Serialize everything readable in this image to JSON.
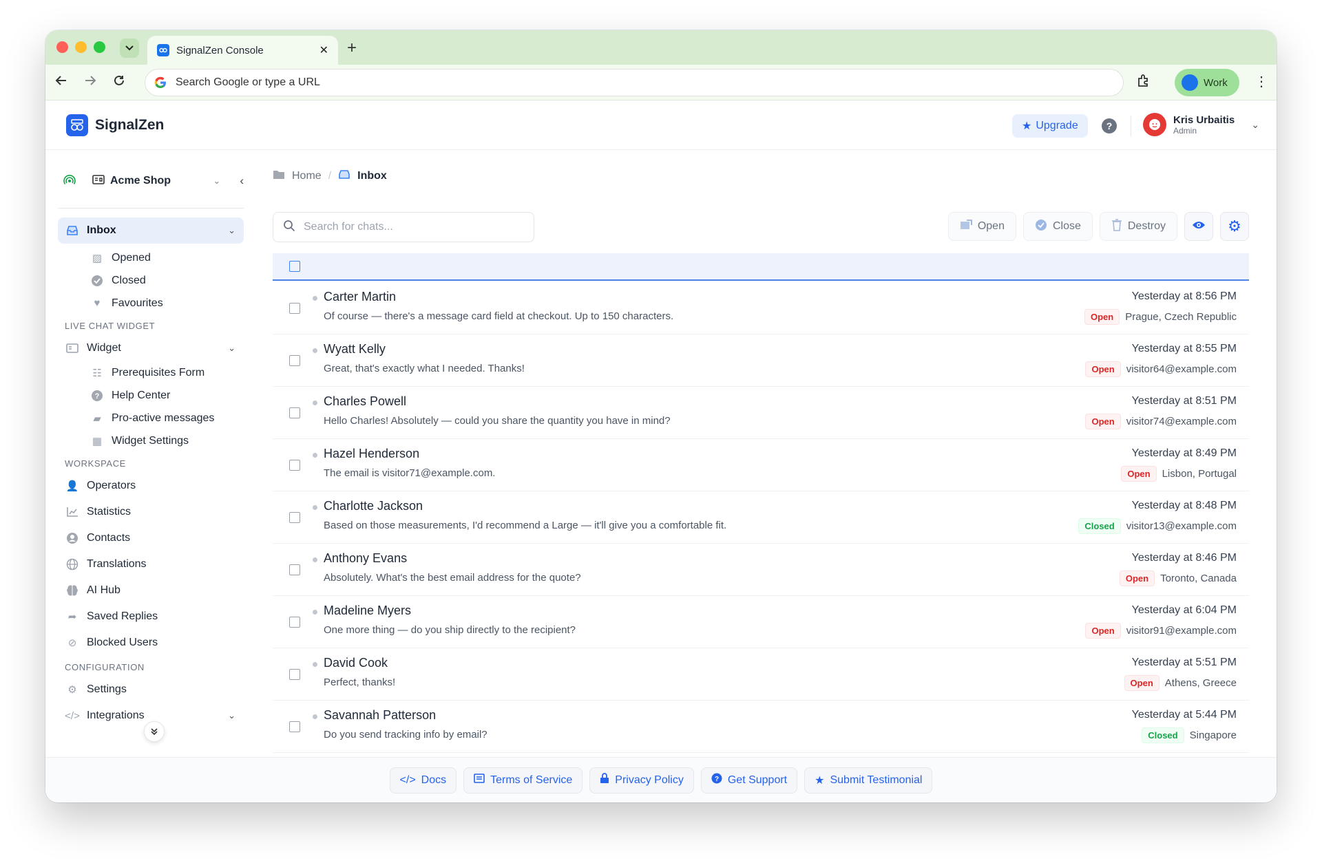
{
  "browser": {
    "tab_title": "SignalZen Console",
    "address_placeholder": "Search Google or type a URL",
    "profile_label": "Work"
  },
  "header": {
    "brand": "SignalZen",
    "upgrade_label": "Upgrade",
    "user_name": "Kris Urbaitis",
    "user_role": "Admin"
  },
  "sidebar": {
    "workspace": "Acme Shop",
    "inbox_label": "Inbox",
    "inbox_sub": [
      {
        "label": "Opened",
        "icon": "inbox-opened-icon"
      },
      {
        "label": "Closed",
        "icon": "check-circle-icon"
      },
      {
        "label": "Favourites",
        "icon": "heart-icon"
      }
    ],
    "section_widget": "LIVE CHAT WIDGET",
    "widget_label": "Widget",
    "widget_sub": [
      {
        "label": "Prerequisites Form",
        "icon": "checklist-icon"
      },
      {
        "label": "Help Center",
        "icon": "question-icon"
      },
      {
        "label": "Pro-active messages",
        "icon": "messages-icon"
      },
      {
        "label": "Widget Settings",
        "icon": "grid-icon"
      }
    ],
    "section_workspace": "WORKSPACE",
    "workspace_items": [
      {
        "label": "Operators",
        "icon": "operators-icon"
      },
      {
        "label": "Statistics",
        "icon": "chart-icon"
      },
      {
        "label": "Contacts",
        "icon": "contacts-icon"
      },
      {
        "label": "Translations",
        "icon": "globe-icon"
      },
      {
        "label": "AI Hub",
        "icon": "brain-icon"
      },
      {
        "label": "Saved Replies",
        "icon": "reply-icon"
      },
      {
        "label": "Blocked Users",
        "icon": "blocked-user-icon"
      }
    ],
    "section_config": "CONFIGURATION",
    "config_items": [
      {
        "label": "Settings",
        "icon": "gear-icon"
      },
      {
        "label": "Integrations",
        "icon": "code-icon"
      }
    ]
  },
  "main": {
    "breadcrumb_home": "Home",
    "breadcrumb_current": "Inbox",
    "search_placeholder": "Search for chats...",
    "actions": {
      "open": "Open",
      "close": "Close",
      "destroy": "Destroy"
    }
  },
  "chats": [
    {
      "name": "Carter Martin",
      "message": "Of course — there's a message card field at checkout. Up to 150 characters.",
      "time": "Yesterday at 8:56 PM",
      "status": "Open",
      "location": "Prague, Czech Republic"
    },
    {
      "name": "Wyatt Kelly",
      "message": "Great, that's exactly what I needed. Thanks!",
      "time": "Yesterday at 8:55 PM",
      "status": "Open",
      "location": "visitor64@example.com"
    },
    {
      "name": "Charles Powell",
      "message": "Hello Charles! Absolutely — could you share the quantity you have in mind?",
      "time": "Yesterday at 8:51 PM",
      "status": "Open",
      "location": "visitor74@example.com"
    },
    {
      "name": "Hazel Henderson",
      "message": "The email is visitor71@example.com.",
      "time": "Yesterday at 8:49 PM",
      "status": "Open",
      "location": "Lisbon, Portugal"
    },
    {
      "name": "Charlotte Jackson",
      "message": "Based on those measurements, I'd recommend a Large — it'll give you a comfortable fit.",
      "time": "Yesterday at 8:48 PM",
      "status": "Closed",
      "location": "visitor13@example.com"
    },
    {
      "name": "Anthony Evans",
      "message": "Absolutely. What's the best email address for the quote?",
      "time": "Yesterday at 8:46 PM",
      "status": "Open",
      "location": "Toronto, Canada"
    },
    {
      "name": "Madeline Myers",
      "message": "One more thing — do you ship directly to the recipient?",
      "time": "Yesterday at 6:04 PM",
      "status": "Open",
      "location": "visitor91@example.com"
    },
    {
      "name": "David Cook",
      "message": "Perfect, thanks!",
      "time": "Yesterday at 5:51 PM",
      "status": "Open",
      "location": "Athens, Greece"
    },
    {
      "name": "Savannah Patterson",
      "message": "Do you send tracking info by email?",
      "time": "Yesterday at 5:44 PM",
      "status": "Closed",
      "location": "Singapore"
    }
  ],
  "footer": {
    "docs": "Docs",
    "terms": "Terms of Service",
    "privacy": "Privacy Policy",
    "support": "Get Support",
    "testimonial": "Submit Testimonial"
  }
}
